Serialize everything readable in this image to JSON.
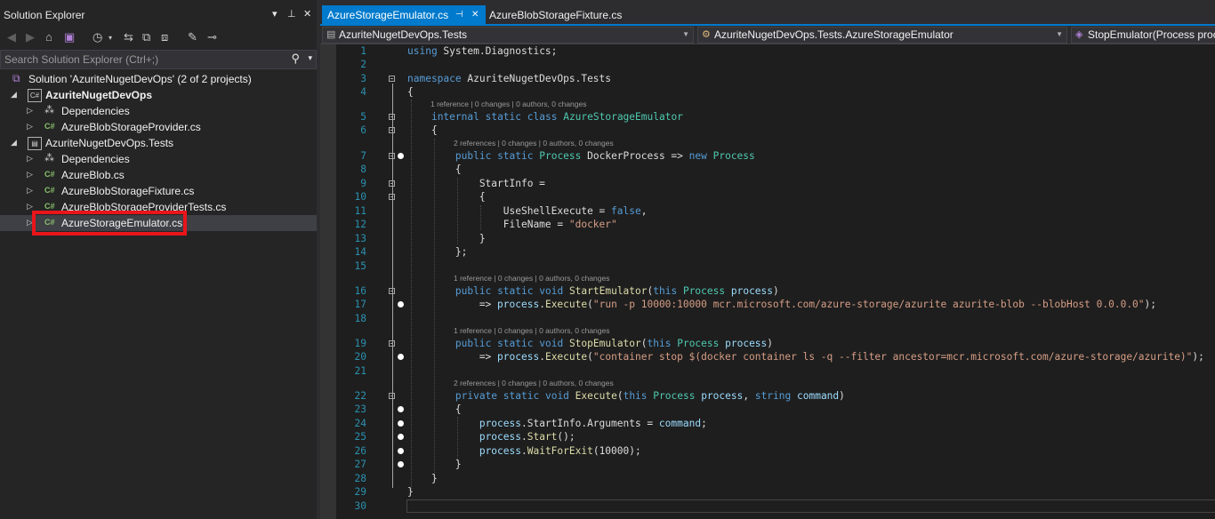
{
  "solution_explorer": {
    "title": "Solution Explorer",
    "search_placeholder": "Search Solution Explorer (Ctrl+;)",
    "tree": [
      {
        "label": "Solution 'AzuriteNugetDevOps' (2 of 2 projects)"
      },
      {
        "label": "AzuriteNugetDevOps"
      },
      {
        "label": "Dependencies"
      },
      {
        "label": "AzureBlobStorageProvider.cs"
      },
      {
        "label": "AzuriteNugetDevOps.Tests"
      },
      {
        "label": "Dependencies"
      },
      {
        "label": "AzureBlob.cs"
      },
      {
        "label": "AzureBlobStorageFixture.cs"
      },
      {
        "label": "AzureBlobStorageProviderTests.cs"
      },
      {
        "label": "AzureStorageEmulator.cs"
      }
    ]
  },
  "editor": {
    "tabs": [
      {
        "label": "AzureStorageEmulator.cs",
        "active": true
      },
      {
        "label": "AzureBlobStorageFixture.cs",
        "active": false
      }
    ],
    "nav": {
      "project": "AzuriteNugetDevOps.Tests",
      "type": "AzuriteNugetDevOps.Tests.AzureStorageEmulator",
      "member": "StopEmulator(Process process)"
    },
    "codelens": [
      "1 reference | 0 changes | 0 authors, 0 changes",
      "2 references | 0 changes | 0 authors, 0 changes",
      "1 reference | 0 changes | 0 authors, 0 changes",
      "1 reference | 0 changes | 0 authors, 0 changes",
      "2 references | 0 changes | 0 authors, 0 changes"
    ],
    "lines": [
      {
        "n": "1",
        "text": "using System.Diagnostics;"
      },
      {
        "n": "2",
        "text": ""
      },
      {
        "n": "3",
        "text": "namespace AzuriteNugetDevOps.Tests"
      },
      {
        "n": "4",
        "text": "{"
      },
      {
        "n": "5",
        "text": "    internal static class AzureStorageEmulator"
      },
      {
        "n": "6",
        "text": "    {"
      },
      {
        "n": "7",
        "text": "        public static Process DockerProcess => new Process"
      },
      {
        "n": "8",
        "text": "        {"
      },
      {
        "n": "9",
        "text": "            StartInfo ="
      },
      {
        "n": "10",
        "text": "            {"
      },
      {
        "n": "11",
        "text": "                UseShellExecute = false,"
      },
      {
        "n": "12",
        "text": "                FileName = \"docker\""
      },
      {
        "n": "13",
        "text": "            }"
      },
      {
        "n": "14",
        "text": "        };"
      },
      {
        "n": "15",
        "text": ""
      },
      {
        "n": "16",
        "text": "        public static void StartEmulator(this Process process)"
      },
      {
        "n": "17",
        "text": "            => process.Execute(\"run -p 10000:10000 mcr.microsoft.com/azure-storage/azurite azurite-blob --blobHost 0.0.0.0\");"
      },
      {
        "n": "18",
        "text": ""
      },
      {
        "n": "19",
        "text": "        public static void StopEmulator(this Process process)"
      },
      {
        "n": "20",
        "text": "            => process.Execute(\"container stop $(docker container ls -q --filter ancestor=mcr.microsoft.com/azure-storage/azurite)\");"
      },
      {
        "n": "21",
        "text": ""
      },
      {
        "n": "22",
        "text": "        private static void Execute(this Process process, string command)"
      },
      {
        "n": "23",
        "text": "        {"
      },
      {
        "n": "24",
        "text": "            process.StartInfo.Arguments = command;"
      },
      {
        "n": "25",
        "text": "            process.Start();"
      },
      {
        "n": "26",
        "text": "            process.WaitForExit(10000);"
      },
      {
        "n": "27",
        "text": "        }"
      },
      {
        "n": "28",
        "text": "    }"
      },
      {
        "n": "29",
        "text": "}"
      },
      {
        "n": "30",
        "text": ""
      }
    ]
  },
  "colors": {
    "accent": "#007acc",
    "highlight_box": "#e8151b",
    "keyword": "#569cd6",
    "type": "#4ec9b0",
    "method": "#dcdcaa",
    "string": "#d69d85",
    "parameter": "#9cdcfe",
    "line_number": "#2b91af"
  },
  "icons": [
    "pin-icon",
    "close-icon",
    "back-icon",
    "forward-icon",
    "home-icon",
    "switch-views-icon",
    "history-icon",
    "sync-icon",
    "collapse-all-icon",
    "show-all-files-icon",
    "properties-icon",
    "preview-icon",
    "search-icon",
    "csharp-file-icon",
    "project-icon",
    "dependencies-icon",
    "solution-icon"
  ]
}
